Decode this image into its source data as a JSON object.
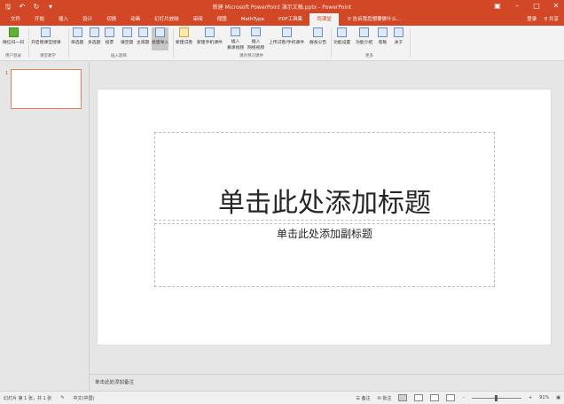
{
  "window": {
    "title": "新建 Microsoft PowerPoint 演示文稿.pptx - PowerPoint",
    "accent_color": "#d24726"
  },
  "qat": [
    "save-icon",
    "undo-icon",
    "redo-icon",
    "customize-icon"
  ],
  "tabs": [
    {
      "label": "文件"
    },
    {
      "label": "开始"
    },
    {
      "label": "插入"
    },
    {
      "label": "设计"
    },
    {
      "label": "切换"
    },
    {
      "label": "动画"
    },
    {
      "label": "幻灯片放映"
    },
    {
      "label": "审阅"
    },
    {
      "label": "视图"
    },
    {
      "label": "MathType"
    },
    {
      "label": "PDF工具集"
    },
    {
      "label": "雨课堂"
    }
  ],
  "tell_me": "告诉我您想要做什么...",
  "user": {
    "name": "登录",
    "share": "共享"
  },
  "ribbon": {
    "buttons": [
      {
        "label": "微信扫一扫"
      },
      {
        "label": "开启雨课堂授课"
      },
      {
        "label": "单选题"
      },
      {
        "label": "多选题"
      },
      {
        "label": "投票"
      },
      {
        "label": "填空题"
      },
      {
        "label": "主观题"
      },
      {
        "label": "批量导入"
      },
      {
        "label": "新建试卷"
      },
      {
        "label": "新建手机课件"
      },
      {
        "label": "插入\n慕课视频"
      },
      {
        "label": "插入\n网络视频"
      },
      {
        "label": "上传试卷/手机课件"
      },
      {
        "label": "群发公告"
      },
      {
        "label": "功能设置"
      },
      {
        "label": "功能介绍"
      },
      {
        "label": "帮助"
      },
      {
        "label": "关于"
      }
    ],
    "groups": [
      "用户登录",
      "课堂教学",
      "插入题目",
      "课外预习课件",
      "更多"
    ]
  },
  "thumbnail": {
    "number": "1"
  },
  "slide": {
    "title_placeholder": "单击此处添加标题",
    "subtitle_placeholder": "单击此处添加副标题"
  },
  "notes": {
    "placeholder": "单击此处添加备注"
  },
  "status": {
    "slide_info": "幻灯片 第 1 张，共 1 张",
    "language": "中文(中国)",
    "notes_btn": "备注",
    "comments_btn": "批注",
    "zoom": "91%"
  }
}
